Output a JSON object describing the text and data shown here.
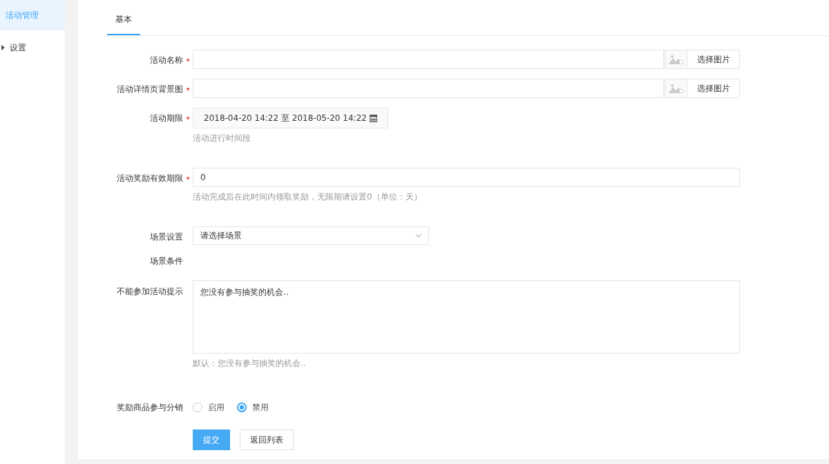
{
  "sidebar": {
    "items": [
      {
        "label": "活动管理",
        "selected": true,
        "kind": "link"
      },
      {
        "label": "设置",
        "selected": false,
        "kind": "group"
      }
    ]
  },
  "tabs": [
    {
      "label": "基本",
      "selected": true
    }
  ],
  "form": {
    "fields": [
      {
        "kind": "image",
        "label": "活动名称",
        "required": true,
        "button": "选择图片"
      },
      {
        "kind": "image",
        "label": "活动详情页背景图",
        "required": true,
        "button": "选择图片"
      },
      {
        "kind": "daterange",
        "label": "活动期限",
        "required": true,
        "value": "2018-04-20 14:22 至 2018-05-20 14:22",
        "hint": "活动进行时间段"
      },
      {
        "kind": "text",
        "label": "活动奖励有效期限",
        "required": true,
        "value": "0",
        "hint": "活动完成后在此时间内领取奖励，无限期请设置0（单位：天）"
      },
      {
        "kind": "select",
        "label": "场景设置",
        "required": false,
        "value": "请选择场景"
      },
      {
        "kind": "static",
        "label": "场景条件",
        "required": false
      },
      {
        "kind": "textarea",
        "label": "不能参加活动提示",
        "required": false,
        "value": "您没有参与抽奖的机会..",
        "hint": "默认：您没有参与抽奖的机会.."
      },
      {
        "kind": "radio",
        "label": "奖励商品参与分销",
        "required": false,
        "options": [
          {
            "label": "启用",
            "selected": false
          },
          {
            "label": "禁用",
            "selected": true
          }
        ]
      }
    ],
    "buttons": [
      {
        "label": "提交",
        "kind": "primary"
      },
      {
        "label": "返回列表",
        "kind": "default"
      }
    ]
  }
}
